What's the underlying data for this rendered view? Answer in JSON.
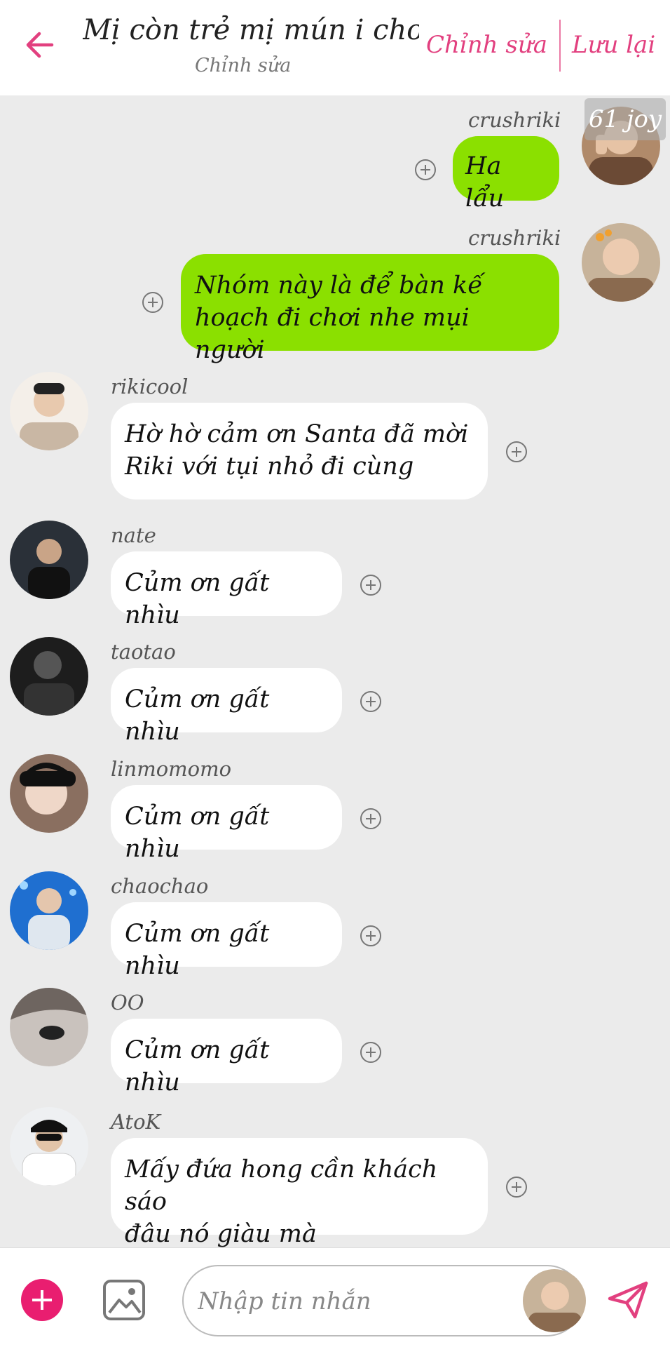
{
  "header": {
    "title": "Mị còn trẻ mị mún i chơi",
    "subtitle": "Chỉnh sửa",
    "edit_label": "Chỉnh sửa",
    "save_label": "Lưu lại",
    "accent": "#e2407f"
  },
  "joy_tag": "61 joy",
  "messages": [
    {
      "sender": "crushriki",
      "lines": [
        "Ha lẩu"
      ],
      "direction": "out"
    },
    {
      "sender": "crushriki",
      "lines": [
        "Nhóm này là để bàn kế",
        "hoạch đi chơi nhe mụi người"
      ],
      "direction": "out"
    },
    {
      "sender": "rikicool",
      "lines": [
        "Hờ hờ cảm ơn Santa đã mời",
        "Riki với tụi nhỏ đi cùng"
      ],
      "direction": "in"
    },
    {
      "sender": "nate",
      "lines": [
        "Củm ơn gất nhìu"
      ],
      "direction": "in"
    },
    {
      "sender": "taotao",
      "lines": [
        "Củm ơn gất nhìu"
      ],
      "direction": "in"
    },
    {
      "sender": "linmomomo",
      "lines": [
        "Củm ơn gất nhìu"
      ],
      "direction": "in"
    },
    {
      "sender": "chaochao",
      "lines": [
        "Củm ơn gất nhìu"
      ],
      "direction": "in"
    },
    {
      "sender": "OO",
      "lines": [
        "Củm ơn gất nhìu"
      ],
      "direction": "in"
    },
    {
      "sender": "AtoK",
      "lines": [
        "Mấy đứa hong cần khách sáo",
        "đâu nó giàu mà"
      ],
      "direction": "in"
    }
  ],
  "composer": {
    "placeholder": "Nhập tin nhắn"
  },
  "colors": {
    "outgoing_bubble": "#8be000",
    "incoming_bubble": "#ffffff",
    "background": "#ebebeb",
    "add_button": "#e91e70"
  },
  "icons": {
    "back": "arrow-left-icon",
    "react": "plus-circle-icon",
    "add": "plus-icon",
    "image": "image-icon",
    "send": "send-icon"
  }
}
